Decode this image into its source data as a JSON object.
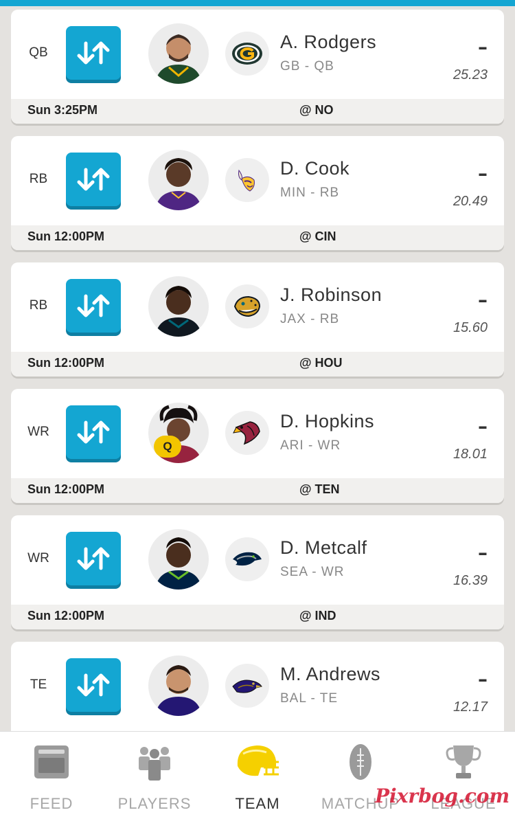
{
  "roster": [
    {
      "pos": "QB",
      "name": "A. Rodgers",
      "team_pos": "GB - QB",
      "actual": "–",
      "projected": "25.23",
      "time": "Sun 3:25PM",
      "opponent": "@ NO",
      "team_color": "#203731",
      "jersey": "#1f4a2c"
    },
    {
      "pos": "RB",
      "name": "D. Cook",
      "team_pos": "MIN - RB",
      "actual": "–",
      "projected": "20.49",
      "time": "Sun 12:00PM",
      "opponent": "@ CIN",
      "team_color": "#4f2683",
      "jersey": "#4f2683"
    },
    {
      "pos": "RB",
      "name": "J. Robinson",
      "team_pos": "JAX - RB",
      "actual": "–",
      "projected": "15.60",
      "time": "Sun 12:00PM",
      "opponent": "@ HOU",
      "team_color": "#006778",
      "jersey": "#101820"
    },
    {
      "pos": "WR",
      "name": "D. Hopkins",
      "team_pos": "ARI - WR",
      "actual": "–",
      "projected": "18.01",
      "time": "Sun 12:00PM",
      "opponent": "@ TEN",
      "team_color": "#97233f",
      "jersey": "#97233f",
      "injury": "Q"
    },
    {
      "pos": "WR",
      "name": "D. Metcalf",
      "team_pos": "SEA - WR",
      "actual": "–",
      "projected": "16.39",
      "time": "Sun 12:00PM",
      "opponent": "@ IND",
      "team_color": "#002244",
      "jersey": "#002244"
    },
    {
      "pos": "TE",
      "name": "M. Andrews",
      "team_pos": "BAL - TE",
      "actual": "–",
      "projected": "12.17",
      "time": "",
      "opponent": "",
      "team_color": "#241773",
      "jersey": "#241773"
    }
  ],
  "tabs": [
    {
      "label": "FEED",
      "icon": "feed-icon"
    },
    {
      "label": "PLAYERS",
      "icon": "players-icon"
    },
    {
      "label": "TEAM",
      "icon": "helmet-icon",
      "active": true
    },
    {
      "label": "MATCHUP",
      "icon": "football-icon"
    },
    {
      "label": "LEAGUE",
      "icon": "trophy-icon"
    }
  ],
  "watermark": "Pixrbog.com",
  "colors": {
    "accent": "#14a6d2",
    "active_icon": "#f5d000",
    "injury_badge": "#f2c500"
  }
}
